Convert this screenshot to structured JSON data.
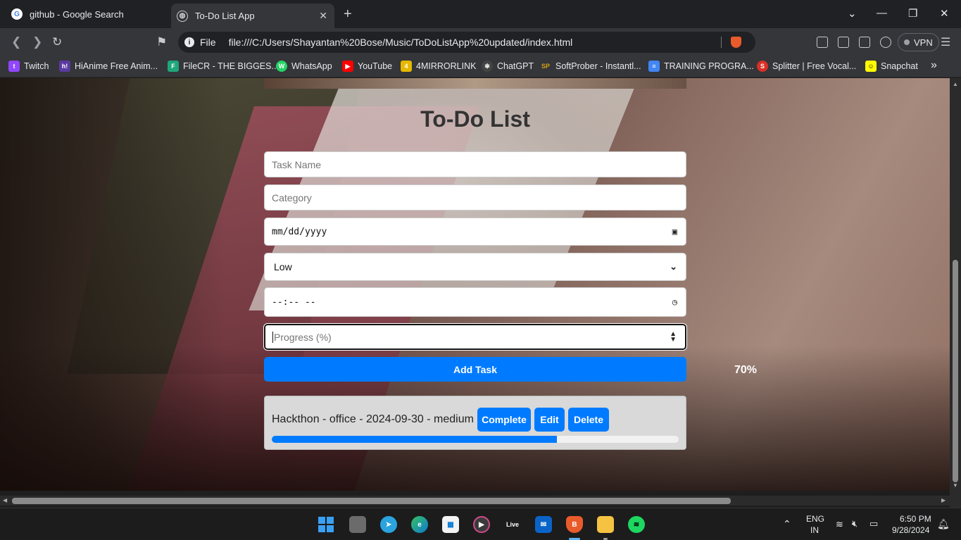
{
  "browser": {
    "tabs": [
      {
        "title": "github - Google Search",
        "icon": "google-icon"
      },
      {
        "title": "To-Do List App",
        "icon": "globe-icon",
        "active": true
      }
    ],
    "url_scheme": "File",
    "url": "file:///C:/Users/Shayantan%20Bose/Music/ToDoListApp%20updated/index.html",
    "vpn_label": "VPN",
    "bookmarks": [
      {
        "label": "Twitch",
        "color": "#9146ff",
        "glyph": "t"
      },
      {
        "label": "HiAnime Free Anim...",
        "color": "#5a3aa0",
        "glyph": "h!"
      },
      {
        "label": "FileCR - THE BIGGES...",
        "color": "#1fa67a",
        "glyph": "F"
      },
      {
        "label": "WhatsApp",
        "color": "#25d366",
        "glyph": "W"
      },
      {
        "label": "YouTube",
        "color": "#ff0000",
        "glyph": "▶"
      },
      {
        "label": "4MIRRORLINK",
        "color": "#e6b800",
        "glyph": "4"
      },
      {
        "label": "ChatGPT",
        "color": "#444444",
        "glyph": "✻"
      },
      {
        "label": "SoftProber - Instantl...",
        "color": "#d4a017",
        "glyph": "SP"
      },
      {
        "label": "TRAINING PROGRA...",
        "color": "#4285f4",
        "glyph": "≡"
      },
      {
        "label": "Splitter | Free Vocal...",
        "color": "#d93025",
        "glyph": "S"
      },
      {
        "label": "Snapchat",
        "color": "#fffc00",
        "glyph": "☺"
      }
    ]
  },
  "app": {
    "title": "To-Do List",
    "task_name_placeholder": "Task Name",
    "category_placeholder": "Category",
    "date_value": "mm/dd/yyyy",
    "priority_selected": "Low",
    "time_value": "--:-- --",
    "progress_placeholder": "Progress (%)",
    "add_button": "Add Task",
    "tasks": [
      {
        "text": "Hackthon - office - 2024-09-30 - medium",
        "complete_label": "Complete",
        "edit_label": "Edit",
        "delete_label": "Delete",
        "progress": 70,
        "progress_label": "70%"
      }
    ],
    "accent_color": "#007bff"
  },
  "taskbar": {
    "language": "ENG",
    "region": "IN",
    "time": "6:50 PM",
    "date": "9/28/2024",
    "apps": [
      "windows-start",
      "task-view",
      "telegram",
      "edge",
      "store",
      "media-player",
      "live",
      "mail",
      "brave",
      "file-explorer",
      "spotify"
    ]
  }
}
